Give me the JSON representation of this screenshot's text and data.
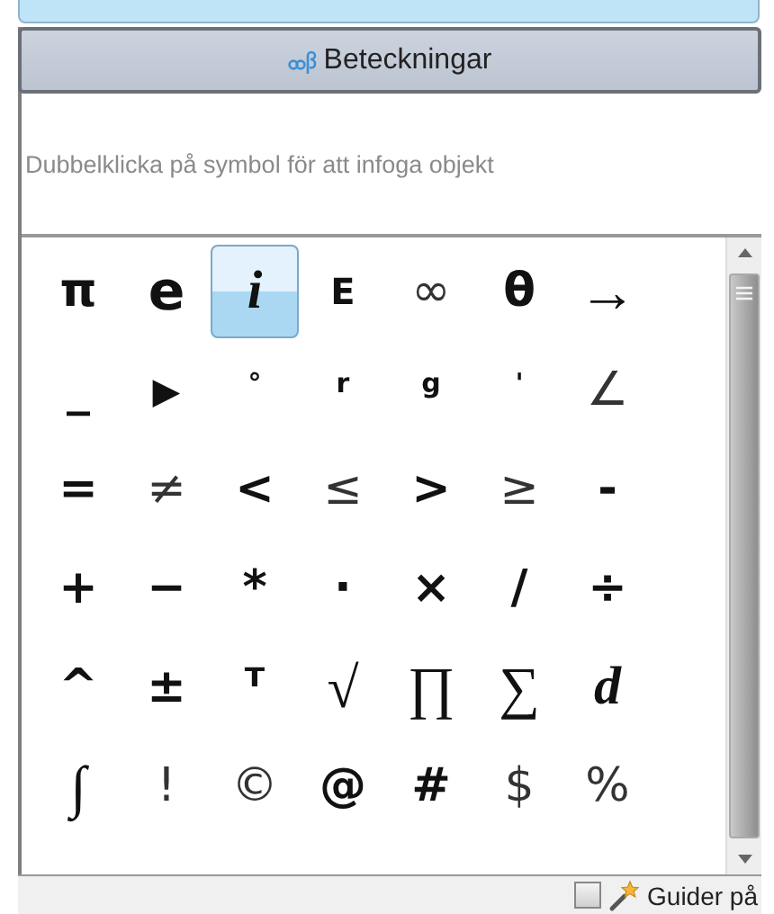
{
  "header_button": {
    "label": "Beteckningar"
  },
  "hint": "Dubbelklicka på symbol för att infoga objekt",
  "symbols": [
    {
      "text": "π",
      "kind": "sans",
      "selected": false
    },
    {
      "text": "e",
      "kind": "boldserif",
      "selected": false
    },
    {
      "text": "i",
      "kind": "italic",
      "selected": true
    },
    {
      "text": "E",
      "kind": "small",
      "selected": false
    },
    {
      "text": "∞",
      "kind": "light",
      "selected": false
    },
    {
      "text": "θ",
      "kind": "sans",
      "selected": false
    },
    {
      "text": "→",
      "kind": "serif",
      "selected": false
    },
    {
      "text": "_",
      "kind": "sans",
      "selected": false
    },
    {
      "text": "▶",
      "kind": "small",
      "selected": false
    },
    {
      "text": "°",
      "kind": "tiny",
      "selected": false
    },
    {
      "text": "r",
      "kind": "tiny",
      "selected": false
    },
    {
      "text": "g",
      "kind": "tiny",
      "selected": false
    },
    {
      "text": "'",
      "kind": "tiny",
      "selected": false
    },
    {
      "text": "∠",
      "kind": "light",
      "selected": false
    },
    {
      "text": "=",
      "kind": "sans",
      "selected": false
    },
    {
      "text": "≠",
      "kind": "light",
      "selected": false
    },
    {
      "text": "<",
      "kind": "sans",
      "selected": false
    },
    {
      "text": "≤",
      "kind": "light",
      "selected": false
    },
    {
      "text": ">",
      "kind": "sans",
      "selected": false
    },
    {
      "text": "≥",
      "kind": "light",
      "selected": false
    },
    {
      "text": "-",
      "kind": "sans",
      "selected": false
    },
    {
      "text": "+",
      "kind": "sans",
      "selected": false
    },
    {
      "text": "−",
      "kind": "sans",
      "selected": false
    },
    {
      "text": "*",
      "kind": "sans",
      "selected": false
    },
    {
      "text": "·",
      "kind": "sans",
      "selected": false
    },
    {
      "text": "×",
      "kind": "sans",
      "selected": false
    },
    {
      "text": "/",
      "kind": "sans",
      "selected": false
    },
    {
      "text": "÷",
      "kind": "sans",
      "selected": false
    },
    {
      "text": "^",
      "kind": "sans",
      "selected": false
    },
    {
      "text": "±",
      "kind": "sans",
      "selected": false
    },
    {
      "text": "ᵀ",
      "kind": "sans",
      "selected": false
    },
    {
      "text": "√",
      "kind": "serif",
      "selected": false
    },
    {
      "text": "∏",
      "kind": "serif",
      "selected": false
    },
    {
      "text": "∑",
      "kind": "serif",
      "selected": false
    },
    {
      "text": "d",
      "kind": "italic",
      "selected": false
    },
    {
      "text": "∫",
      "kind": "serif",
      "selected": false
    },
    {
      "text": "!",
      "kind": "light",
      "selected": false
    },
    {
      "text": "©",
      "kind": "light",
      "selected": false
    },
    {
      "text": "@",
      "kind": "sans",
      "selected": false
    },
    {
      "text": "#",
      "kind": "sans",
      "selected": false
    },
    {
      "text": "$",
      "kind": "light",
      "selected": false
    },
    {
      "text": "%",
      "kind": "light",
      "selected": false
    }
  ],
  "footer": {
    "checkbox_checked": false,
    "label": "Guider på"
  }
}
